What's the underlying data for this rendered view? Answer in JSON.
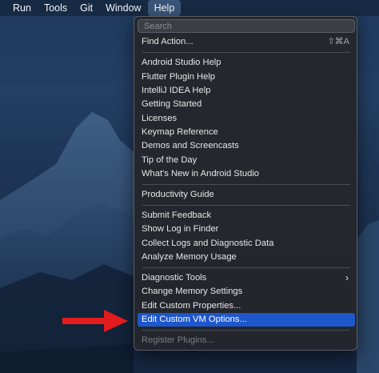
{
  "menubar": {
    "items": [
      {
        "label": "Run"
      },
      {
        "label": "Tools"
      },
      {
        "label": "Git"
      },
      {
        "label": "Window"
      },
      {
        "label": "Help"
      }
    ]
  },
  "help_menu": {
    "search_placeholder": "Search",
    "find_action": {
      "label": "Find Action...",
      "shortcut": "⇧⌘A"
    },
    "items": [
      {
        "label": "Android Studio Help"
      },
      {
        "label": "Flutter Plugin Help"
      },
      {
        "label": "IntelliJ IDEA Help"
      },
      {
        "label": "Getting Started"
      },
      {
        "label": "Licenses"
      },
      {
        "label": "Keymap Reference"
      },
      {
        "label": "Demos and Screencasts"
      },
      {
        "label": "Tip of the Day"
      },
      {
        "label": "What's New in Android Studio"
      },
      {
        "label": "Productivity Guide"
      },
      {
        "label": "Submit Feedback"
      },
      {
        "label": "Show Log in Finder"
      },
      {
        "label": "Collect Logs and Diagnostic Data"
      },
      {
        "label": "Analyze Memory Usage"
      },
      {
        "label": "Diagnostic Tools"
      },
      {
        "label": "Change Memory Settings"
      },
      {
        "label": "Edit Custom Properties..."
      },
      {
        "label": "Edit Custom VM Options..."
      },
      {
        "label": "Register Plugins..."
      }
    ]
  },
  "colors": {
    "highlight": "#1e56cc",
    "annotation_arrow": "#e21c1c"
  }
}
